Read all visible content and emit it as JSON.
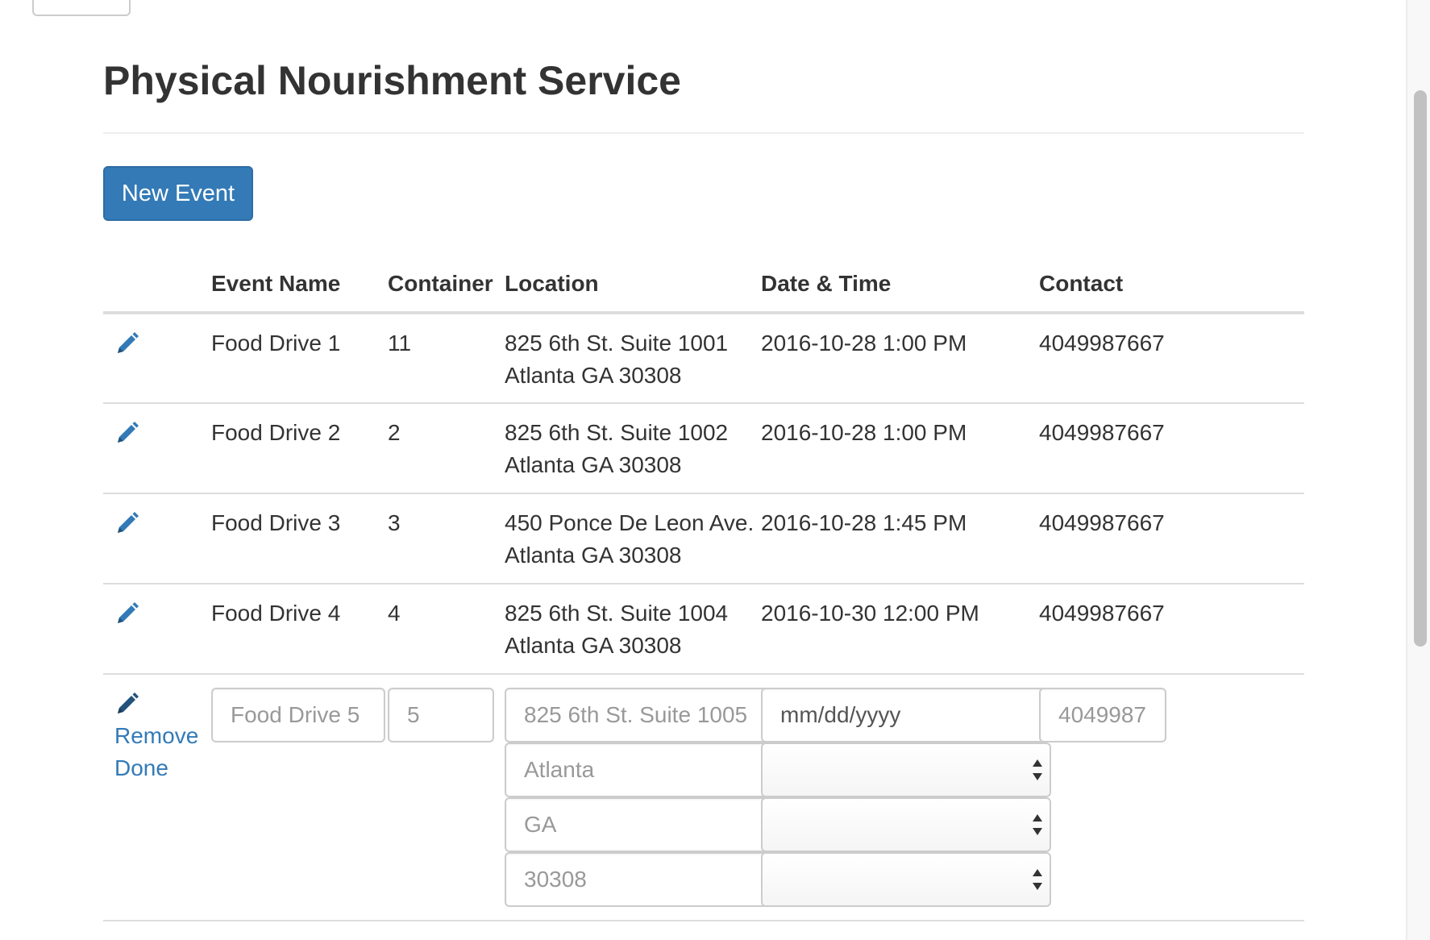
{
  "page": {
    "title": "Physical Nourishment Service",
    "new_event_label": "New Event"
  },
  "table": {
    "headers": {
      "edit": "",
      "event_name": "Event Name",
      "container": "Container",
      "location": "Location",
      "date_time": "Date & Time",
      "contact": "Contact"
    },
    "rows": [
      {
        "event_name": "Food Drive 1",
        "container": "11",
        "location_line1": "825 6th St. Suite 1001",
        "location_line2": "Atlanta GA 30308",
        "date_time": "2016-10-28 1:00 PM",
        "contact": "4049987667"
      },
      {
        "event_name": "Food Drive 2",
        "container": "2",
        "location_line1": "825 6th St. Suite 1002",
        "location_line2": "Atlanta GA 30308",
        "date_time": "2016-10-28 1:00 PM",
        "contact": "4049987667"
      },
      {
        "event_name": "Food Drive 3",
        "container": "3",
        "location_line1": "450 Ponce De Leon Ave.",
        "location_line2": "Atlanta GA 30308",
        "date_time": "2016-10-28 1:45 PM",
        "contact": "4049987667"
      },
      {
        "event_name": "Food Drive 4",
        "container": "4",
        "location_line1": "825 6th St. Suite 1004",
        "location_line2": "Atlanta GA 30308",
        "date_time": "2016-10-30 12:00 PM",
        "contact": "4049987667"
      }
    ],
    "edit_row": {
      "remove_label": "Remove",
      "done_label": "Done",
      "event_name_placeholder": "Food Drive 5",
      "container_placeholder": "5",
      "street_placeholder": "825 6th St. Suite 1005",
      "city_placeholder": "Atlanta",
      "state_placeholder": "GA",
      "zip_placeholder": "30308",
      "date_placeholder": "mm/dd/yyyy",
      "hour_value": "",
      "minute_value": "",
      "ampm_value": "",
      "contact_placeholder": "4049987"
    }
  },
  "colors": {
    "primary": "#337ab7",
    "text": "#333333",
    "border": "#dddddd"
  },
  "icons": {
    "edit": "pencil-icon"
  }
}
